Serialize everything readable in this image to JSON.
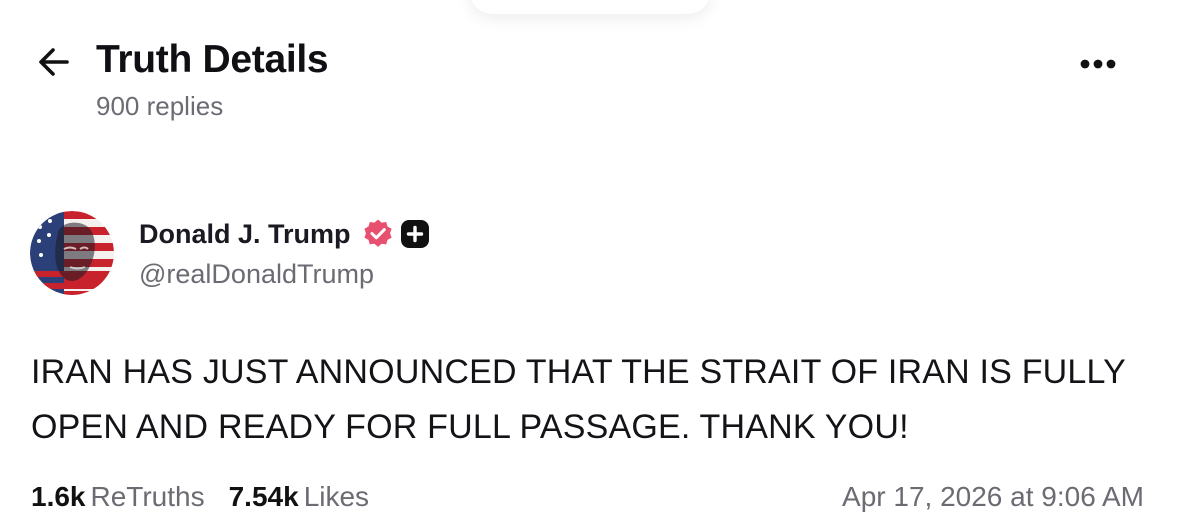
{
  "header": {
    "title": "Truth Details",
    "subtitle": "900 replies",
    "back_icon": "arrow-left-icon",
    "more_icon": "more-horizontal-icon"
  },
  "post": {
    "author": {
      "name": "Donald J. Trump",
      "handle": "@realDonaldTrump",
      "avatar_icon": "avatar-flag-portrait",
      "verified_icon": "verified-badge-icon",
      "plus_icon": "plus-badge-icon"
    },
    "text": "IRAN HAS JUST ANNOUNCED THAT THE STRAIT OF IRAN IS FULLY OPEN AND READY FOR FULL PASSAGE. THANK YOU!",
    "stats": {
      "retruths_count": "1.6k",
      "retruths_label": "ReTruths",
      "likes_count": "7.54k",
      "likes_label": "Likes"
    },
    "timestamp": "Apr 17, 2026 at 9:06 AM"
  },
  "colors": {
    "text_primary": "#111111",
    "text_secondary": "#6b6b73",
    "verified_badge": "#e8506f",
    "plus_badge": "#111111",
    "background": "#ffffff"
  }
}
